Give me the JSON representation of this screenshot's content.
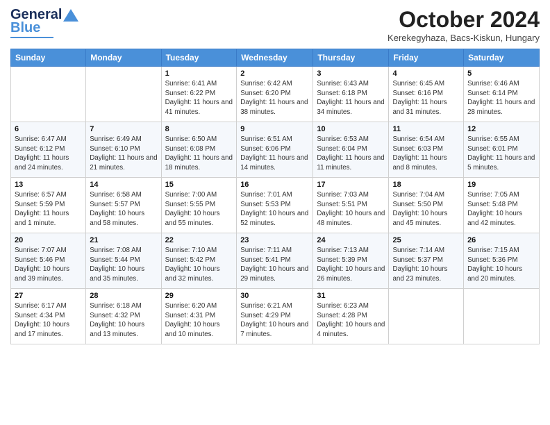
{
  "header": {
    "logo_line1": "General",
    "logo_line2": "Blue",
    "month_title": "October 2024",
    "location": "Kerekegyhaza, Bacs-Kiskun, Hungary"
  },
  "days_of_week": [
    "Sunday",
    "Monday",
    "Tuesday",
    "Wednesday",
    "Thursday",
    "Friday",
    "Saturday"
  ],
  "weeks": [
    [
      {
        "day": "",
        "sunrise": "",
        "sunset": "",
        "daylight": ""
      },
      {
        "day": "",
        "sunrise": "",
        "sunset": "",
        "daylight": ""
      },
      {
        "day": "1",
        "sunrise": "Sunrise: 6:41 AM",
        "sunset": "Sunset: 6:22 PM",
        "daylight": "Daylight: 11 hours and 41 minutes."
      },
      {
        "day": "2",
        "sunrise": "Sunrise: 6:42 AM",
        "sunset": "Sunset: 6:20 PM",
        "daylight": "Daylight: 11 hours and 38 minutes."
      },
      {
        "day": "3",
        "sunrise": "Sunrise: 6:43 AM",
        "sunset": "Sunset: 6:18 PM",
        "daylight": "Daylight: 11 hours and 34 minutes."
      },
      {
        "day": "4",
        "sunrise": "Sunrise: 6:45 AM",
        "sunset": "Sunset: 6:16 PM",
        "daylight": "Daylight: 11 hours and 31 minutes."
      },
      {
        "day": "5",
        "sunrise": "Sunrise: 6:46 AM",
        "sunset": "Sunset: 6:14 PM",
        "daylight": "Daylight: 11 hours and 28 minutes."
      }
    ],
    [
      {
        "day": "6",
        "sunrise": "Sunrise: 6:47 AM",
        "sunset": "Sunset: 6:12 PM",
        "daylight": "Daylight: 11 hours and 24 minutes."
      },
      {
        "day": "7",
        "sunrise": "Sunrise: 6:49 AM",
        "sunset": "Sunset: 6:10 PM",
        "daylight": "Daylight: 11 hours and 21 minutes."
      },
      {
        "day": "8",
        "sunrise": "Sunrise: 6:50 AM",
        "sunset": "Sunset: 6:08 PM",
        "daylight": "Daylight: 11 hours and 18 minutes."
      },
      {
        "day": "9",
        "sunrise": "Sunrise: 6:51 AM",
        "sunset": "Sunset: 6:06 PM",
        "daylight": "Daylight: 11 hours and 14 minutes."
      },
      {
        "day": "10",
        "sunrise": "Sunrise: 6:53 AM",
        "sunset": "Sunset: 6:04 PM",
        "daylight": "Daylight: 11 hours and 11 minutes."
      },
      {
        "day": "11",
        "sunrise": "Sunrise: 6:54 AM",
        "sunset": "Sunset: 6:03 PM",
        "daylight": "Daylight: 11 hours and 8 minutes."
      },
      {
        "day": "12",
        "sunrise": "Sunrise: 6:55 AM",
        "sunset": "Sunset: 6:01 PM",
        "daylight": "Daylight: 11 hours and 5 minutes."
      }
    ],
    [
      {
        "day": "13",
        "sunrise": "Sunrise: 6:57 AM",
        "sunset": "Sunset: 5:59 PM",
        "daylight": "Daylight: 11 hours and 1 minute."
      },
      {
        "day": "14",
        "sunrise": "Sunrise: 6:58 AM",
        "sunset": "Sunset: 5:57 PM",
        "daylight": "Daylight: 10 hours and 58 minutes."
      },
      {
        "day": "15",
        "sunrise": "Sunrise: 7:00 AM",
        "sunset": "Sunset: 5:55 PM",
        "daylight": "Daylight: 10 hours and 55 minutes."
      },
      {
        "day": "16",
        "sunrise": "Sunrise: 7:01 AM",
        "sunset": "Sunset: 5:53 PM",
        "daylight": "Daylight: 10 hours and 52 minutes."
      },
      {
        "day": "17",
        "sunrise": "Sunrise: 7:03 AM",
        "sunset": "Sunset: 5:51 PM",
        "daylight": "Daylight: 10 hours and 48 minutes."
      },
      {
        "day": "18",
        "sunrise": "Sunrise: 7:04 AM",
        "sunset": "Sunset: 5:50 PM",
        "daylight": "Daylight: 10 hours and 45 minutes."
      },
      {
        "day": "19",
        "sunrise": "Sunrise: 7:05 AM",
        "sunset": "Sunset: 5:48 PM",
        "daylight": "Daylight: 10 hours and 42 minutes."
      }
    ],
    [
      {
        "day": "20",
        "sunrise": "Sunrise: 7:07 AM",
        "sunset": "Sunset: 5:46 PM",
        "daylight": "Daylight: 10 hours and 39 minutes."
      },
      {
        "day": "21",
        "sunrise": "Sunrise: 7:08 AM",
        "sunset": "Sunset: 5:44 PM",
        "daylight": "Daylight: 10 hours and 35 minutes."
      },
      {
        "day": "22",
        "sunrise": "Sunrise: 7:10 AM",
        "sunset": "Sunset: 5:42 PM",
        "daylight": "Daylight: 10 hours and 32 minutes."
      },
      {
        "day": "23",
        "sunrise": "Sunrise: 7:11 AM",
        "sunset": "Sunset: 5:41 PM",
        "daylight": "Daylight: 10 hours and 29 minutes."
      },
      {
        "day": "24",
        "sunrise": "Sunrise: 7:13 AM",
        "sunset": "Sunset: 5:39 PM",
        "daylight": "Daylight: 10 hours and 26 minutes."
      },
      {
        "day": "25",
        "sunrise": "Sunrise: 7:14 AM",
        "sunset": "Sunset: 5:37 PM",
        "daylight": "Daylight: 10 hours and 23 minutes."
      },
      {
        "day": "26",
        "sunrise": "Sunrise: 7:15 AM",
        "sunset": "Sunset: 5:36 PM",
        "daylight": "Daylight: 10 hours and 20 minutes."
      }
    ],
    [
      {
        "day": "27",
        "sunrise": "Sunrise: 6:17 AM",
        "sunset": "Sunset: 4:34 PM",
        "daylight": "Daylight: 10 hours and 17 minutes."
      },
      {
        "day": "28",
        "sunrise": "Sunrise: 6:18 AM",
        "sunset": "Sunset: 4:32 PM",
        "daylight": "Daylight: 10 hours and 13 minutes."
      },
      {
        "day": "29",
        "sunrise": "Sunrise: 6:20 AM",
        "sunset": "Sunset: 4:31 PM",
        "daylight": "Daylight: 10 hours and 10 minutes."
      },
      {
        "day": "30",
        "sunrise": "Sunrise: 6:21 AM",
        "sunset": "Sunset: 4:29 PM",
        "daylight": "Daylight: 10 hours and 7 minutes."
      },
      {
        "day": "31",
        "sunrise": "Sunrise: 6:23 AM",
        "sunset": "Sunset: 4:28 PM",
        "daylight": "Daylight: 10 hours and 4 minutes."
      },
      {
        "day": "",
        "sunrise": "",
        "sunset": "",
        "daylight": ""
      },
      {
        "day": "",
        "sunrise": "",
        "sunset": "",
        "daylight": ""
      }
    ]
  ]
}
